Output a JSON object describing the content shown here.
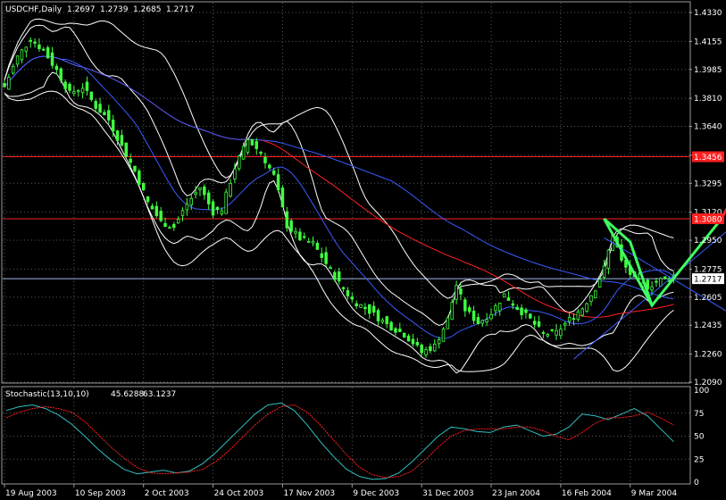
{
  "chart_data": [
    {
      "type": "candlestick",
      "title": "USDCHF,Daily",
      "ohlc": {
        "open": "1.2697",
        "high": "1.2739",
        "low": "1.2685",
        "close": "1.2717"
      },
      "y_ticks": [
        "1.4330",
        "1.4155",
        "1.3985",
        "1.3810",
        "1.3640",
        "1.3465",
        "1.3295",
        "1.3120",
        "1.2950",
        "1.2775",
        "1.2605",
        "1.2435",
        "1.2260",
        "1.2090"
      ],
      "ylim": [
        1.209,
        1.433
      ],
      "x_ticks": [
        "19 Aug 2003",
        "10 Sep 2003",
        "2 Oct 2003",
        "24 Oct 2003",
        "17 Nov 2003",
        "9 Dec 2003",
        "31 Dec 2003",
        "23 Jan 2004",
        "16 Feb 2004",
        "9 Mar 2004"
      ],
      "x_tick_index": [
        0,
        16,
        32,
        48,
        64,
        80,
        96,
        112,
        128,
        144
      ],
      "bar_count": 155,
      "anchor_closes": [
        [
          0,
          1.388
        ],
        [
          3,
          1.406
        ],
        [
          6,
          1.417
        ],
        [
          9,
          1.41
        ],
        [
          12,
          1.398
        ],
        [
          15,
          1.384
        ],
        [
          18,
          1.388
        ],
        [
          21,
          1.376
        ],
        [
          24,
          1.368
        ],
        [
          27,
          1.352
        ],
        [
          30,
          1.337
        ],
        [
          33,
          1.318
        ],
        [
          36,
          1.306
        ],
        [
          39,
          1.303
        ],
        [
          42,
          1.317
        ],
        [
          45,
          1.327
        ],
        [
          48,
          1.312
        ],
        [
          50,
          1.314
        ],
        [
          53,
          1.339
        ],
        [
          56,
          1.356
        ],
        [
          59,
          1.348
        ],
        [
          62,
          1.334
        ],
        [
          65,
          1.304
        ],
        [
          68,
          1.296
        ],
        [
          71,
          1.293
        ],
        [
          74,
          1.281
        ],
        [
          77,
          1.269
        ],
        [
          80,
          1.259
        ],
        [
          84,
          1.252
        ],
        [
          88,
          1.244
        ],
        [
          92,
          1.238
        ],
        [
          94,
          1.233
        ],
        [
          96,
          1.227
        ],
        [
          99,
          1.231
        ],
        [
          102,
          1.247
        ],
        [
          104,
          1.268
        ],
        [
          106,
          1.253
        ],
        [
          109,
          1.245
        ],
        [
          112,
          1.251
        ],
        [
          115,
          1.262
        ],
        [
          118,
          1.254
        ],
        [
          121,
          1.247
        ],
        [
          124,
          1.238
        ],
        [
          127,
          1.239
        ],
        [
          130,
          1.247
        ],
        [
          133,
          1.254
        ],
        [
          136,
          1.266
        ],
        [
          138,
          1.278
        ],
        [
          140,
          1.299
        ],
        [
          142,
          1.282
        ],
        [
          145,
          1.271
        ],
        [
          148,
          1.267
        ],
        [
          151,
          1.271
        ],
        [
          154,
          1.2717
        ]
      ],
      "horizontal_lines": [
        {
          "value": 1.3456,
          "label": "1.3456",
          "color": "#ff2020"
        },
        {
          "value": 1.308,
          "label": "1.3080",
          "color": "#ff2020"
        },
        {
          "value": 1.2717,
          "label": "1.2717",
          "color": "#9fb6e8"
        }
      ],
      "colors": {
        "up": "#40ff40",
        "down": "#40ff40",
        "bands": "#ffffff",
        "ma_red": "#ff2020",
        "ma_blue": "#3a5cff",
        "projection_green": "#40ff60",
        "projection_red": "#ff2020"
      }
    },
    {
      "type": "line",
      "title": "Stochastic(13,10,10)",
      "values_header": [
        "45.6288",
        "63.1237"
      ],
      "ylim": [
        0,
        100
      ],
      "y_ticks": [
        "100",
        "75",
        "50",
        "25",
        "0"
      ],
      "series": [
        {
          "color": "#30c0c0",
          "values": [
            78,
            82,
            84,
            80,
            73,
            63,
            50,
            36,
            24,
            14,
            9,
            11,
            13,
            10,
            12,
            20,
            32,
            46,
            60,
            74,
            84,
            86,
            78,
            62,
            44,
            28,
            14,
            6,
            3,
            4,
            10,
            22,
            36,
            50,
            60,
            58,
            55,
            54,
            60,
            62,
            56,
            50,
            52,
            60,
            74,
            72,
            68,
            74,
            80,
            72,
            58,
            44
          ]
        },
        {
          "color": "#ff2020",
          "values": [
            70,
            76,
            80,
            82,
            80,
            76,
            66,
            52,
            38,
            26,
            16,
            10,
            9,
            10,
            11,
            14,
            22,
            34,
            48,
            62,
            74,
            82,
            84,
            76,
            62,
            46,
            30,
            16,
            8,
            5,
            6,
            12,
            24,
            38,
            50,
            56,
            58,
            58,
            58,
            60,
            60,
            56,
            50,
            46,
            54,
            64,
            70,
            70,
            72,
            76,
            70,
            62
          ]
        }
      ]
    }
  ]
}
